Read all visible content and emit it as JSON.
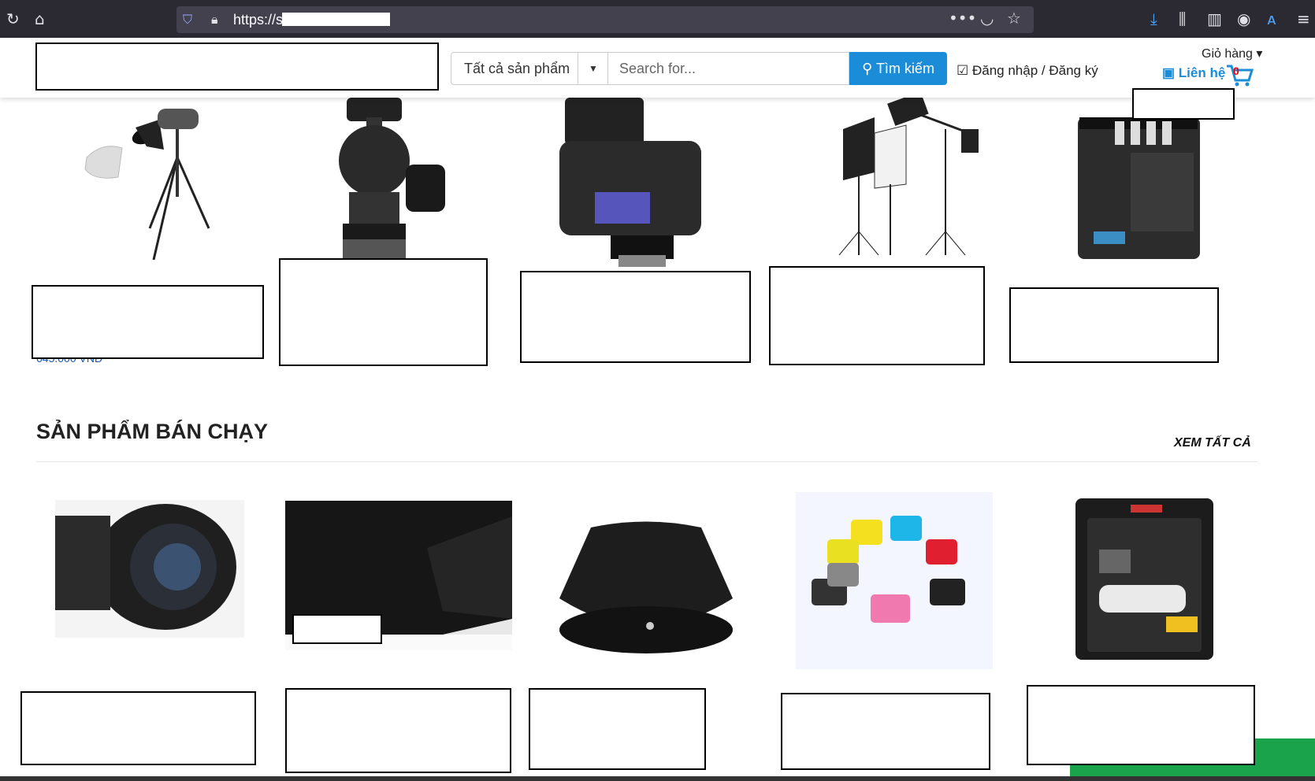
{
  "browser": {
    "url": "https://s"
  },
  "header": {
    "category_select": "Tất cả sản phẩm",
    "search_placeholder": "Search for...",
    "search_button": "Tìm kiếm",
    "login_link": "Đăng nhập / Đăng ký",
    "cart_label": "Giỏ hàng",
    "contact_link": "Liên hệ",
    "cart_count": "0"
  },
  "featured": {
    "price_peek": "645.000 VNĐ"
  },
  "bestsellers": {
    "title": "SẢN PHẨM BÁN CHẠY",
    "view_all": "XEM TẤT CẢ"
  },
  "colors": {
    "accent": "#1a8cd8",
    "browser_bg": "#2b2a33",
    "green_banner": "#1aa34a"
  }
}
